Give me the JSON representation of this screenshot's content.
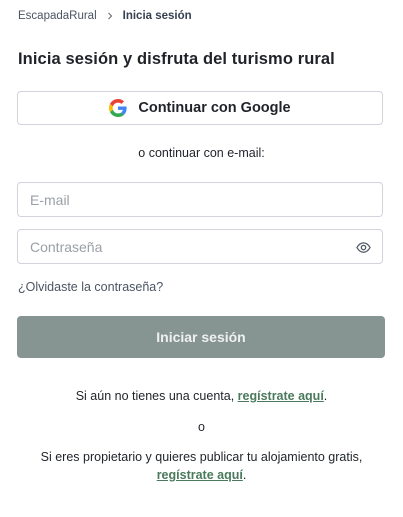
{
  "breadcrumb": {
    "home": "EscapadaRural",
    "current": "Inicia sesión"
  },
  "page_title": "Inicia sesión y disfruta del turismo rural",
  "google_button": {
    "label": "Continuar con Google",
    "icon": "google-icon"
  },
  "divider_text": "o continuar con e-mail:",
  "email_field": {
    "value": "",
    "placeholder": "E-mail"
  },
  "password_field": {
    "value": "",
    "placeholder": "Contraseña",
    "toggle_icon": "eye-icon"
  },
  "forgot_password": "¿Olvidaste la contraseña?",
  "submit_button": {
    "label": "Iniciar sesión",
    "color": "#879592"
  },
  "register": {
    "prefix": "Si aún no tienes una cuenta, ",
    "link": "regístrate aquí",
    "suffix": "."
  },
  "or_text": "o",
  "owner": {
    "prefix": "Si eres propietario y quieres publicar tu alojamiento gratis,",
    "link": "regístrate aquí",
    "suffix": "."
  },
  "colors": {
    "link_green": "#4a7a5b",
    "border": "#d1d5db"
  }
}
